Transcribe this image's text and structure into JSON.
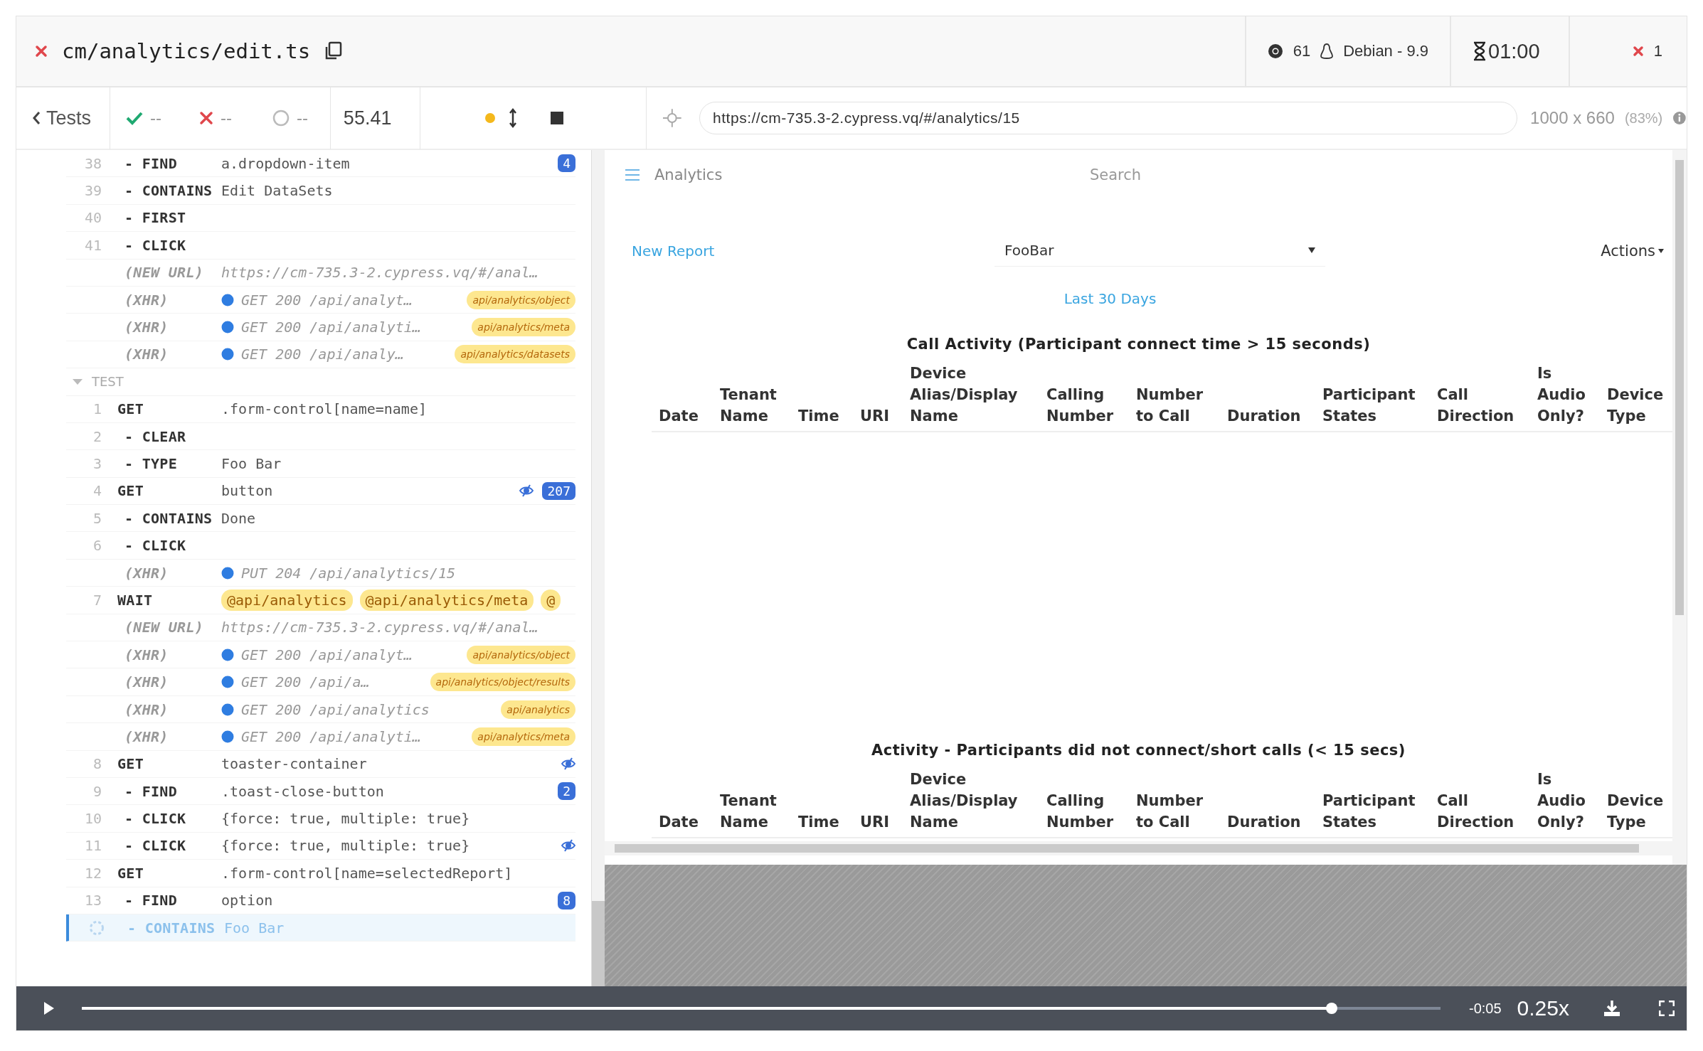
{
  "header": {
    "failed": true,
    "spec_path": "cm/analytics/edit.ts",
    "browser_version": "61",
    "os": "Debian - 9.9",
    "duration": "01:00",
    "failed_count": "1"
  },
  "toolbar": {
    "back_label": "Tests",
    "passed": "--",
    "failed": "--",
    "pending": "--",
    "duration": "55.41",
    "url": "https://cm-735.3-2.cypress.vq/#/analytics/15",
    "viewport": "1000 x 660",
    "scale": "(83%)"
  },
  "commands": [
    {
      "kind": "command",
      "number": "38",
      "name": "- FIND",
      "message": "a.dropdown-item",
      "badge": "4",
      "hidden": false,
      "running": false
    },
    {
      "kind": "command",
      "number": "39",
      "name": "- CONTAINS",
      "message": "Edit DataSets",
      "hidden": false,
      "running": false
    },
    {
      "kind": "command",
      "number": "40",
      "name": "- FIRST",
      "hidden": false,
      "running": false
    },
    {
      "kind": "command",
      "number": "41",
      "name": "- CLICK",
      "hidden": false,
      "running": false
    },
    {
      "kind": "url",
      "name": "(NEW URL)",
      "message": "https://cm-735.3-2.cypress.vq/#/anal…"
    },
    {
      "kind": "xhr",
      "name": "(XHR)",
      "message": "GET 200 /api/analyt…",
      "alias": "api/analytics/object"
    },
    {
      "kind": "xhr",
      "name": "(XHR)",
      "message": "GET 200 /api/analyti…",
      "alias": "api/analytics/meta"
    },
    {
      "kind": "xhr",
      "name": "(XHR)",
      "message": "GET 200 /api/analy…",
      "alias": "api/analytics/datasets"
    },
    {
      "kind": "section",
      "name": "TEST"
    },
    {
      "kind": "command",
      "number": "1",
      "name": "GET",
      "message": ".form-control[name=name]",
      "hidden": false,
      "running": false
    },
    {
      "kind": "command",
      "number": "2",
      "name": "- CLEAR",
      "hidden": false,
      "running": false
    },
    {
      "kind": "command",
      "number": "3",
      "name": "- TYPE",
      "message": "Foo Bar",
      "hidden": false,
      "running": false
    },
    {
      "kind": "command",
      "number": "4",
      "name": "GET",
      "message": "button",
      "badge": "207",
      "hidden": true,
      "running": false
    },
    {
      "kind": "command",
      "number": "5",
      "name": "- CONTAINS",
      "message": "Done",
      "hidden": false,
      "running": false
    },
    {
      "kind": "command",
      "number": "6",
      "name": "- CLICK",
      "hidden": false,
      "running": false
    },
    {
      "kind": "xhr",
      "name": "(XHR)",
      "message": "PUT 204 /api/analytics/15"
    },
    {
      "kind": "wait",
      "number": "7",
      "name": "WAIT",
      "aliases": [
        "@api/analytics",
        "@api/analytics/meta",
        "@"
      ]
    },
    {
      "kind": "url",
      "name": "(NEW URL)",
      "message": "https://cm-735.3-2.cypress.vq/#/anal…"
    },
    {
      "kind": "xhr",
      "name": "(XHR)",
      "message": "GET 200 /api/analyt…",
      "alias": "api/analytics/object"
    },
    {
      "kind": "xhr",
      "name": "(XHR)",
      "message": "GET 200 /api/a…",
      "alias": "api/analytics/object/results"
    },
    {
      "kind": "xhr",
      "name": "(XHR)",
      "message": "GET 200 /api/analytics",
      "alias": "api/analytics"
    },
    {
      "kind": "xhr",
      "name": "(XHR)",
      "message": "GET 200 /api/analyti…",
      "alias": "api/analytics/meta"
    },
    {
      "kind": "command",
      "number": "8",
      "name": "GET",
      "message": "toaster-container",
      "hidden": true,
      "running": false
    },
    {
      "kind": "command",
      "number": "9",
      "name": "- FIND",
      "message": ".toast-close-button",
      "badge": "2",
      "hidden": false,
      "running": false
    },
    {
      "kind": "command",
      "number": "10",
      "name": "- CLICK",
      "message": "{force: true, multiple: true}",
      "hidden": false,
      "running": false
    },
    {
      "kind": "command",
      "number": "11",
      "name": "- CLICK",
      "message": "{force: true, multiple: true}",
      "hidden": true,
      "running": false
    },
    {
      "kind": "command",
      "number": "12",
      "name": "GET",
      "message": ".form-control[name=selectedReport]",
      "hidden": false,
      "running": false
    },
    {
      "kind": "command",
      "number": "13",
      "name": "- FIND",
      "message": "option",
      "badge": "8",
      "hidden": false,
      "running": false
    },
    {
      "kind": "command",
      "name": "- CONTAINS",
      "message": "Foo Bar",
      "hidden": false,
      "running": true
    }
  ],
  "app": {
    "title": "Analytics",
    "search": {
      "placeholder": "Search"
    },
    "new_report": "New Report",
    "report_select": {
      "value": "FooBar"
    },
    "actions": "Actions",
    "date_range": "Last 30 Days",
    "tables": [
      {
        "title": "Call Activity (Participant connect time > 15 seconds)",
        "columns": [
          "Date",
          "Tenant Name",
          "Time",
          "URI",
          "Device Alias/Display Name",
          "Calling Number",
          "Number to Call",
          "Duration",
          "Participant States",
          "Call Direction",
          "Is Audio Only?",
          "Device Type"
        ]
      },
      {
        "title": "Activity - Participants did not connect/short calls (< 15 secs)",
        "columns": [
          "Date",
          "Tenant Name",
          "Time",
          "URI",
          "Device Alias/Display Name",
          "Calling Number",
          "Number to Call",
          "Duration",
          "Participant States",
          "Call Direction",
          "Is Audio Only?",
          "Device Type"
        ]
      }
    ]
  },
  "player": {
    "level": 0.92,
    "remaining": "-0:05",
    "speed": "0.25x"
  }
}
